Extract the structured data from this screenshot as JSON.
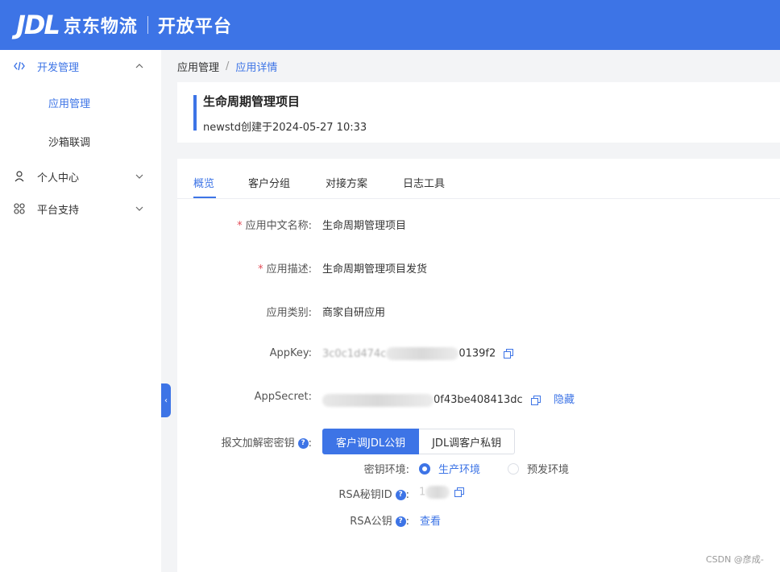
{
  "header": {
    "logo_mark": "JDL",
    "logo_cn": "京东物流",
    "portal": "开放平台"
  },
  "sidebar": {
    "groups": [
      {
        "label": "开发管理",
        "icon": "code-icon",
        "expanded": true,
        "children": [
          {
            "label": "应用管理",
            "selected": true
          },
          {
            "label": "沙箱联调",
            "selected": false
          }
        ]
      },
      {
        "label": "个人中心",
        "icon": "user-icon",
        "expanded": false
      },
      {
        "label": "平台支持",
        "icon": "grid-icon",
        "expanded": false
      }
    ]
  },
  "breadcrumb": {
    "parent": "应用管理",
    "separator": "/",
    "current": "应用详情"
  },
  "app_header": {
    "name": "生命周期管理项目",
    "created": "newstd创建于2024-05-27 10:33"
  },
  "tabs": [
    "概览",
    "客户分组",
    "对接方案",
    "日志工具"
  ],
  "active_tab": "概览",
  "details": {
    "name": {
      "label": "应用中文名称:",
      "value": "生命周期管理项目",
      "required": "*"
    },
    "desc": {
      "label": "应用描述:",
      "value": "生命周期管理项目发货",
      "required": "*"
    },
    "category": {
      "label": "应用类别:",
      "value": "商家自研应用"
    },
    "appkey": {
      "label": "AppKey:",
      "visible_prefix": "3c0c1d474c",
      "visible_suffix": "0139f2"
    },
    "appsecret": {
      "label": "AppSecret:",
      "visible_suffix": "0f43be408413dc",
      "hide_link": "隐藏"
    },
    "crypto": {
      "label": "报文加解密密钥",
      "buttons": [
        "客户调JDL公钥",
        "JDL调客户私钥"
      ],
      "active_button": "客户调JDL公钥",
      "env_label": "密钥环境:",
      "env_options": [
        "生产环境",
        "预发环境"
      ],
      "env_selected": "生产环境",
      "rsa_id_label": "RSA秘钥ID",
      "rsa_id_visible": "1",
      "rsa_pub_label": "RSA公钥",
      "rsa_pub_link": "查看"
    }
  },
  "watermark": "CSDN @彦成-",
  "colors": {
    "primary": "#3d74e6",
    "required": "#e34d59"
  }
}
